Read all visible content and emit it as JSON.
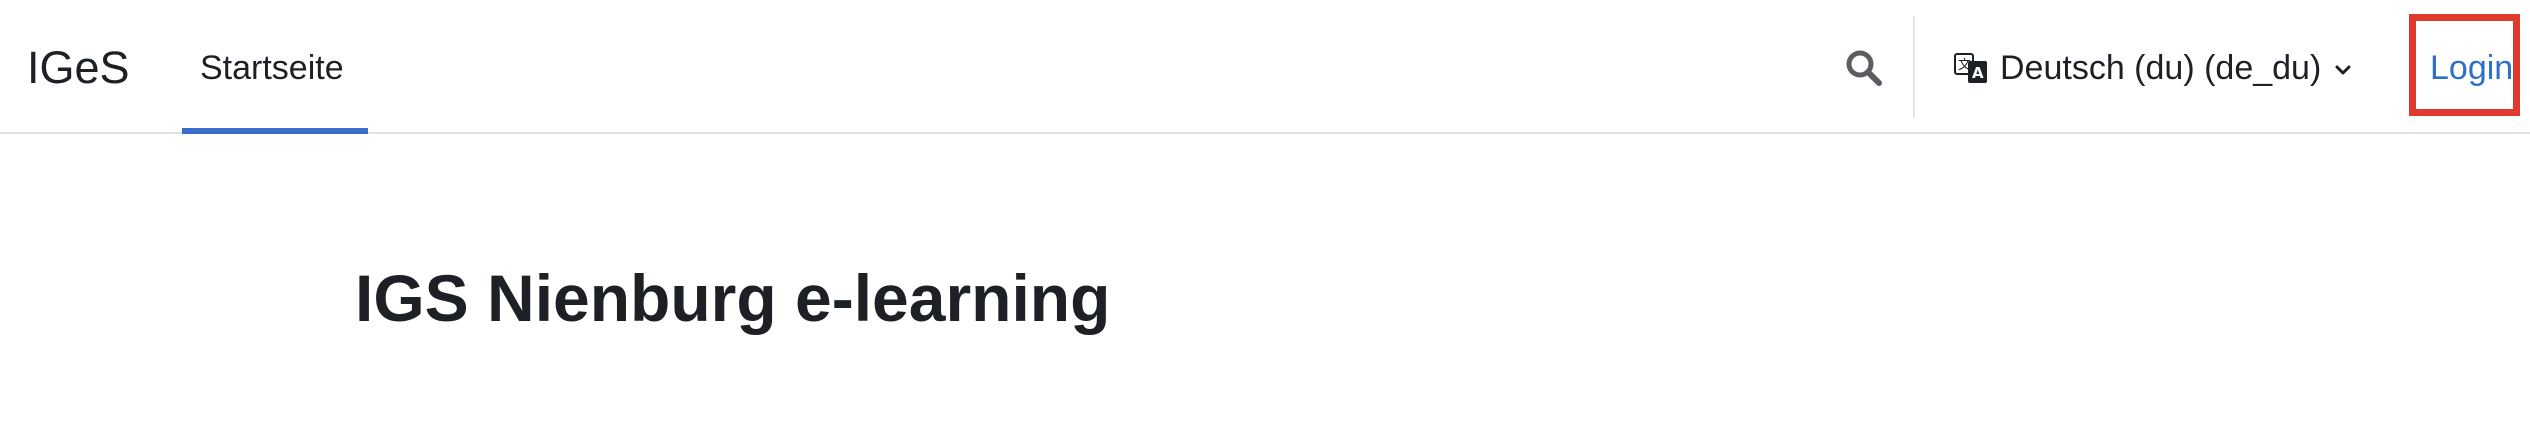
{
  "navbar": {
    "brand": "IGeS",
    "tabs": [
      {
        "label": "Startseite",
        "active": true
      }
    ],
    "search_icon": "search-icon",
    "language": {
      "icon": "language-icon",
      "label": "Deutsch (du) (de_du)",
      "chevron_icon": "chevron-down-icon"
    },
    "login_label": "Login",
    "highlight_color": "#e03a2f",
    "active_tab_color": "#3a6dcb",
    "link_color": "#2f6fc8"
  },
  "main": {
    "title": "IGS Nienburg e-learning"
  }
}
